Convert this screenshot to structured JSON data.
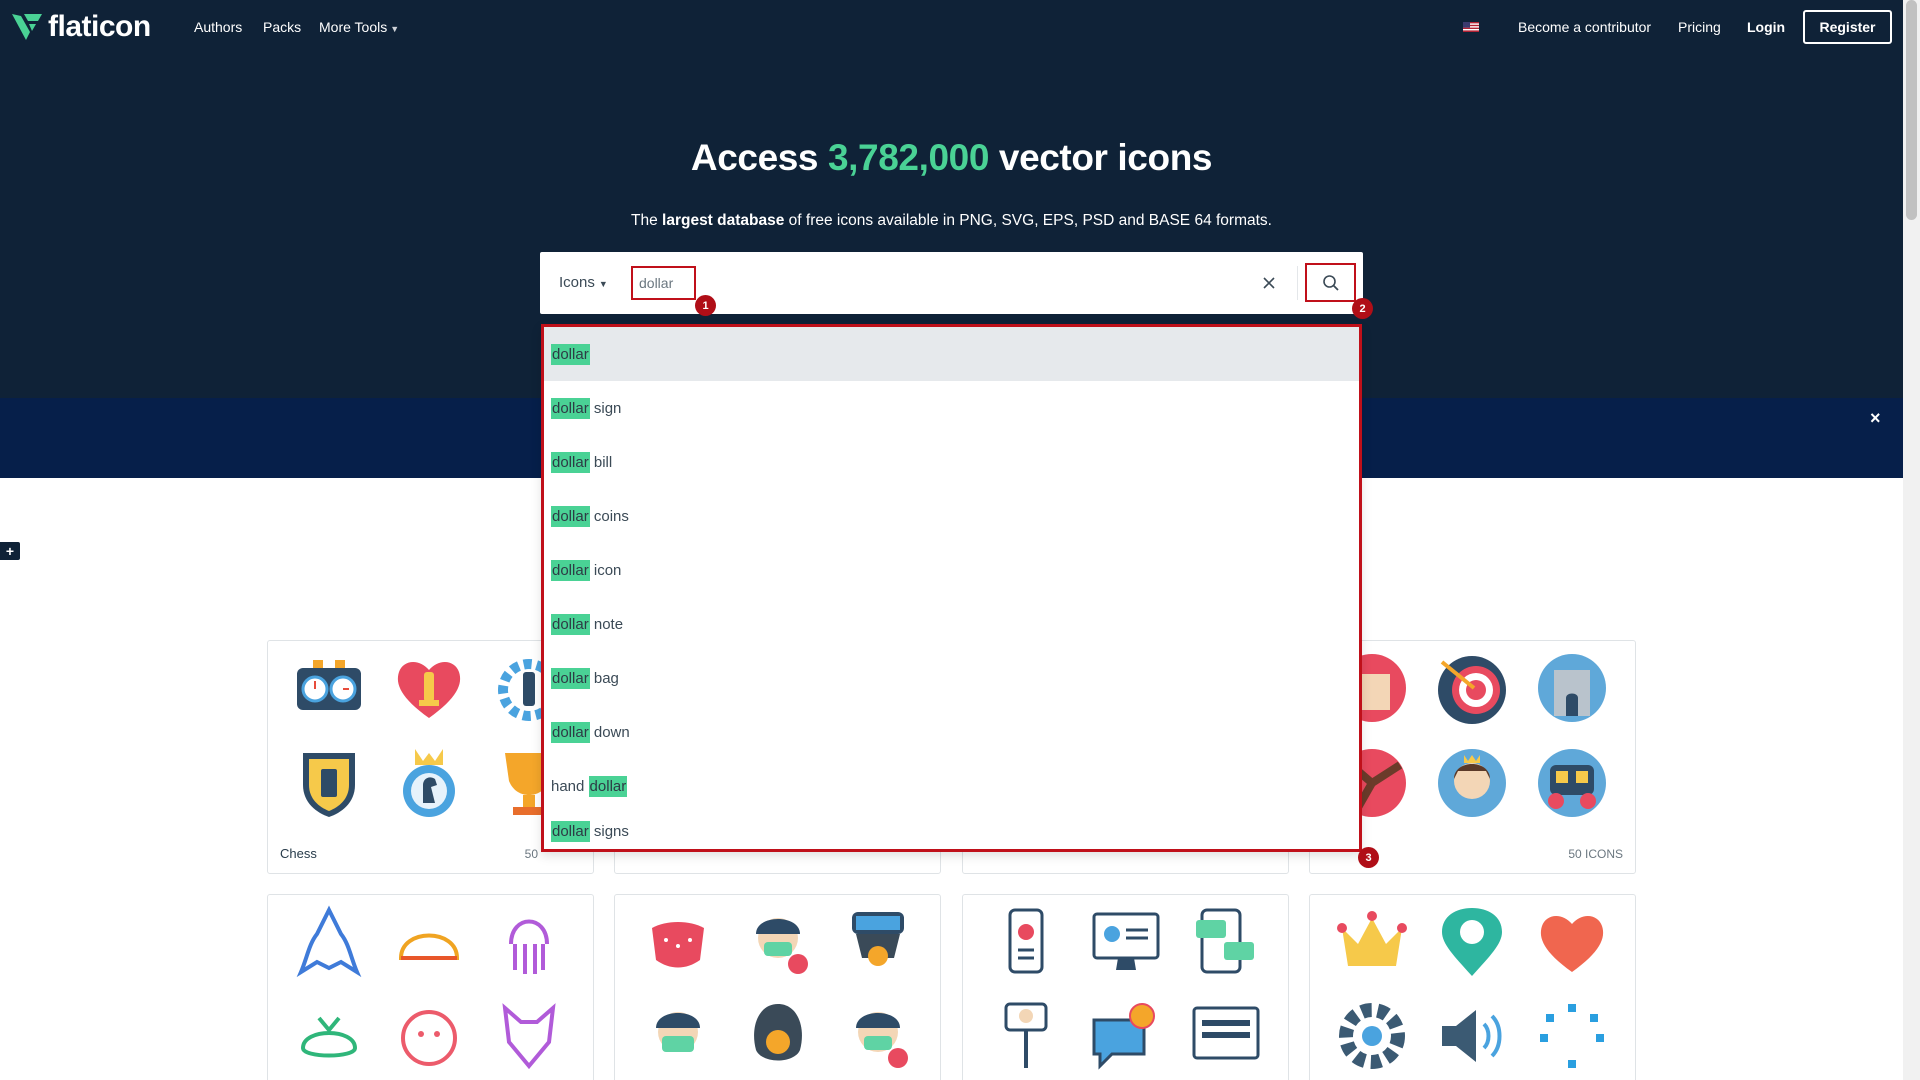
{
  "nav": {
    "logo": "flaticon",
    "links": [
      "Authors",
      "Packs",
      "More Tools"
    ],
    "become_contributor": "Become a contributor",
    "pricing": "Pricing",
    "login": "Login",
    "register": "Register"
  },
  "hero": {
    "title_pre": "Access ",
    "title_count": "3,782,000",
    "title_post": " vector icons",
    "subtitle_pre": "The ",
    "subtitle_bold": "largest database",
    "subtitle_post": " of free icons available in PNG, SVG, EPS, PSD and BASE 64 formats."
  },
  "search": {
    "type_label": "Icons",
    "value": "dollar",
    "query_highlight": "dollar"
  },
  "markers": [
    "1",
    "2",
    "3"
  ],
  "suggestions": [
    {
      "before": "",
      "match": "dollar",
      "after": ""
    },
    {
      "before": "",
      "match": "dollar",
      "after": " sign"
    },
    {
      "before": "",
      "match": "dollar",
      "after": " bill"
    },
    {
      "before": "",
      "match": "dollar",
      "after": " coins"
    },
    {
      "before": "",
      "match": "dollar",
      "after": " icon"
    },
    {
      "before": "",
      "match": "dollar",
      "after": " note"
    },
    {
      "before": "",
      "match": "dollar",
      "after": " bag"
    },
    {
      "before": "",
      "match": "dollar",
      "after": " down"
    },
    {
      "before": "hand ",
      "match": "dollar",
      "after": ""
    },
    {
      "before": "",
      "match": "dollar",
      "after": " signs"
    }
  ],
  "banner": {
    "close_glyph": "×"
  },
  "cards": {
    "chess_title": "Chess",
    "chess_count": "50",
    "right_count": "50 ICONS"
  },
  "colors": {
    "navy": "#0f2237",
    "green_accent": "#4ad295",
    "annotation_red": "#c0101a"
  },
  "icons": [
    "chess-clock-icon",
    "heart-king-icon",
    "gear-chess-icon",
    "rook-shield-icon",
    "knight-medal-icon",
    "trophy-icon",
    "temple-icon",
    "target-arrow-icon",
    "castle-icon",
    "windmill-icon",
    "princess-icon",
    "carriage-icon",
    "shark-icon",
    "turtle-icon",
    "squid-icon",
    "whale-icon",
    "leopard-icon",
    "wolf-icon",
    "face-mask-icon",
    "sick-person-icon",
    "gas-mask-icon",
    "masked-man-icon",
    "respirator-icon",
    "sick-boy-icon",
    "phone-contact-icon",
    "monitor-profile-icon",
    "phone-chat-icon",
    "selfie-stick-icon",
    "chat-bell-icon",
    "laptop-icon",
    "crown-icon",
    "location-pin-icon",
    "heart-icon",
    "settings-gear-icon",
    "speaker-icon",
    "loading-dots-icon"
  ]
}
